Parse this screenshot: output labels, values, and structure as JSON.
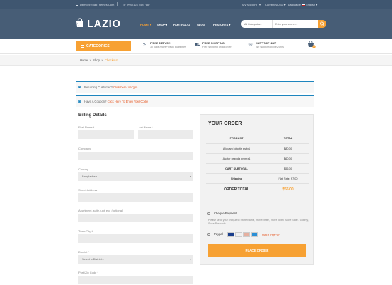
{
  "topbar": {
    "email": "Demo@RoadThemes.Com",
    "phone": "(+00 123 456 789)",
    "account": "My Account",
    "currency_label": "Currency:",
    "currency_value": "USD",
    "language_label": "Language:",
    "language_value": "English"
  },
  "header": {
    "logo": "LAZIO",
    "nav": [
      "HOME",
      "SHOP",
      "PORTFOLIO",
      "BLOG",
      "FEATURES"
    ],
    "search_category": "All Categories",
    "search_placeholder": "Enter your search...",
    "cart_count": "0"
  },
  "service_bar": {
    "categories_label": "CATEGORIES",
    "items": [
      {
        "title": "FREE RETURN",
        "sub": "30 days money back guarantee"
      },
      {
        "title": "FREE SHIPPING",
        "sub": "Free shipping on all order"
      },
      {
        "title": "SUPPORT 24/7",
        "sub": "We support online 24hrs"
      }
    ]
  },
  "breadcrumb": {
    "home": "Home",
    "shop": "Shop",
    "current": "Checkout",
    "separator": "»"
  },
  "notices": {
    "returning_text": "Returning Customer?",
    "returning_link": "Click here to login",
    "coupon_text": "Have A Coupon?",
    "coupon_link": "Click Here To Enter Your Code"
  },
  "billing": {
    "title": "Billing Details",
    "first_name": "First Name *",
    "last_name": "Last Name *",
    "company": "Company",
    "country": "Country",
    "country_value": "Bangladesh",
    "street": "Street Address",
    "apartment": "Apartment, suite, unit etc. (optional)",
    "town": "Town/City *",
    "district": "District *",
    "district_value": "Select a District...",
    "postcode": "Post/Zip Code *"
  },
  "order": {
    "title": "YOUR ORDER",
    "col_product": "PRODUCT",
    "col_total": "TOTAL",
    "items": [
      {
        "name": "Aliquam lobortis est x1",
        "total": "$80.00"
      },
      {
        "name": "Auctor gravida enim x1",
        "total": "$60.00"
      }
    ],
    "subtotal_label": "CART SUBTOTAL",
    "subtotal_value": "$56.00",
    "shipping_label": "Shipping",
    "shipping_value": "Flat Rate: $7.00",
    "total_label": "ORDER TOTAL",
    "total_value": "$56.00",
    "payment_cheque": "Cheque Payment",
    "payment_desc": "Please send your cheque to Store Name, Store Street, Store Town, Store State / County, Store Postcode.",
    "payment_paypal": "Paypal",
    "what_paypal": "what is PayPal?",
    "place_order": "PLACE ORDER"
  },
  "colors": {
    "accent": "#f7a133",
    "header_bg": "#475d76",
    "notice_border": "#1e85be"
  }
}
